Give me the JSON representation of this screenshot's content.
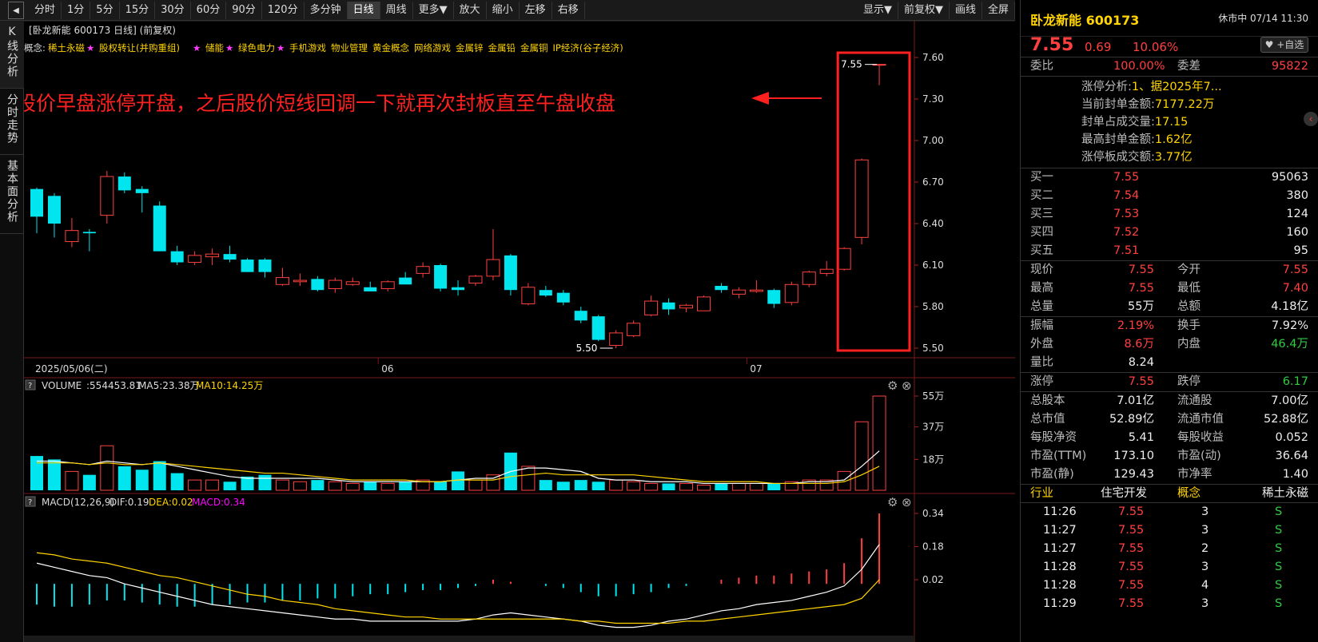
{
  "toolbar": {
    "collapse_glyph": "◀",
    "left": [
      "分时",
      "1分",
      "5分",
      "15分",
      "30分",
      "60分",
      "90分",
      "120分",
      "多分钟",
      "日线",
      "周线",
      "更多▼",
      "放大",
      "缩小",
      "左移",
      "右移"
    ],
    "active": "日线",
    "right": [
      "显示▼",
      "前复权▼",
      "画线",
      "全屏"
    ]
  },
  "left_tabs": [
    "K线分析",
    "分时走势",
    "基本面分析"
  ],
  "kline": {
    "header": "[卧龙新能 600173 日线] (前复权)",
    "concepts_label": "概念:",
    "concepts": [
      "稀土永磁",
      "股权转让(并购重组)",
      "储能",
      "绿色电力",
      "手机游戏",
      "物业管理",
      "黄金概念",
      "网络游戏",
      "金属锌",
      "金属铅",
      "金属铜",
      "IP经济(谷子经济)"
    ],
    "starred": [
      true,
      true,
      true,
      true,
      false,
      false,
      false,
      false,
      false,
      false,
      false,
      false
    ],
    "annotation": "股价早盘涨停开盘，之后股价短线回调一下就再次封板直至午盘收盘",
    "high_marker": "7.55",
    "low_marker": "5.50",
    "date_first": "2025/05/06(二)",
    "month_labels": [
      "06",
      "07"
    ],
    "y_ticks": [
      "7.60",
      "7.30",
      "7.00",
      "6.70",
      "6.40",
      "6.10",
      "5.80",
      "5.50"
    ]
  },
  "volume": {
    "label": "VOLUME",
    "value": ":554453.81",
    "ma5": "MA5:23.38万",
    "ma10": "MA10:14.25万",
    "y_ticks": [
      "55万",
      "37万",
      "18万"
    ]
  },
  "macd": {
    "label": "MACD(12,26,9)",
    "dif": "DIF:0.19",
    "dea": "DEA:0.02",
    "macd": "MACD:0.34",
    "y_ticks": [
      "0.34",
      "0.18",
      "0.02"
    ]
  },
  "colors": {
    "up": "#ff4040",
    "down": "#00e5ee",
    "ma5": "#ffffff",
    "ma10": "#ffd400",
    "box": "#ff2020",
    "annot": "#ff2020",
    "macd_text": "#ff00ff"
  },
  "chart_data": [
    {
      "type": "candlestick",
      "title": "卧龙新能 600173 日线",
      "ylim": [
        5.5,
        7.6
      ],
      "candles": [
        {
          "o": 6.65,
          "h": 6.66,
          "l": 6.33,
          "c": 6.45
        },
        {
          "o": 6.6,
          "h": 6.62,
          "l": 6.3,
          "c": 6.4
        },
        {
          "o": 6.27,
          "h": 6.44,
          "l": 6.23,
          "c": 6.35
        },
        {
          "o": 6.34,
          "h": 6.36,
          "l": 6.2,
          "c": 6.33
        },
        {
          "o": 6.46,
          "h": 6.78,
          "l": 6.4,
          "c": 6.74
        },
        {
          "o": 6.74,
          "h": 6.77,
          "l": 6.62,
          "c": 6.64
        },
        {
          "o": 6.65,
          "h": 6.67,
          "l": 6.48,
          "c": 6.62
        },
        {
          "o": 6.53,
          "h": 6.56,
          "l": 6.2,
          "c": 6.2
        },
        {
          "o": 6.2,
          "h": 6.24,
          "l": 6.1,
          "c": 6.12
        },
        {
          "o": 6.12,
          "h": 6.2,
          "l": 6.1,
          "c": 6.17
        },
        {
          "o": 6.16,
          "h": 6.22,
          "l": 6.1,
          "c": 6.18
        },
        {
          "o": 6.18,
          "h": 6.24,
          "l": 6.12,
          "c": 6.14
        },
        {
          "o": 6.14,
          "h": 6.15,
          "l": 6.05,
          "c": 6.05
        },
        {
          "o": 6.14,
          "h": 6.15,
          "l": 6.01,
          "c": 6.05
        },
        {
          "o": 5.96,
          "h": 6.08,
          "l": 5.95,
          "c": 6.01
        },
        {
          "o": 5.98,
          "h": 6.04,
          "l": 5.95,
          "c": 5.99
        },
        {
          "o": 6.0,
          "h": 6.02,
          "l": 5.91,
          "c": 5.92
        },
        {
          "o": 5.93,
          "h": 6.01,
          "l": 5.9,
          "c": 5.99
        },
        {
          "o": 5.96,
          "h": 6.01,
          "l": 5.95,
          "c": 5.98
        },
        {
          "o": 5.94,
          "h": 5.98,
          "l": 5.92,
          "c": 5.91
        },
        {
          "o": 5.93,
          "h": 5.99,
          "l": 5.91,
          "c": 5.98
        },
        {
          "o": 6.01,
          "h": 6.05,
          "l": 5.97,
          "c": 5.96
        },
        {
          "o": 6.04,
          "h": 6.12,
          "l": 6.01,
          "c": 6.09
        },
        {
          "o": 6.1,
          "h": 6.11,
          "l": 5.91,
          "c": 5.93
        },
        {
          "o": 5.94,
          "h": 5.99,
          "l": 5.88,
          "c": 5.92
        },
        {
          "o": 5.97,
          "h": 6.03,
          "l": 5.95,
          "c": 6.02
        },
        {
          "o": 6.02,
          "h": 6.36,
          "l": 5.99,
          "c": 6.14
        },
        {
          "o": 6.17,
          "h": 6.18,
          "l": 5.88,
          "c": 5.92
        },
        {
          "o": 5.82,
          "h": 5.97,
          "l": 5.81,
          "c": 5.94
        },
        {
          "o": 5.92,
          "h": 5.95,
          "l": 5.87,
          "c": 5.88
        },
        {
          "o": 5.9,
          "h": 5.92,
          "l": 5.81,
          "c": 5.83
        },
        {
          "o": 5.77,
          "h": 5.8,
          "l": 5.68,
          "c": 5.7
        },
        {
          "o": 5.73,
          "h": 5.74,
          "l": 5.55,
          "c": 5.56
        },
        {
          "o": 5.52,
          "h": 5.63,
          "l": 5.5,
          "c": 5.61
        },
        {
          "o": 5.59,
          "h": 5.7,
          "l": 5.58,
          "c": 5.68
        },
        {
          "o": 5.74,
          "h": 5.88,
          "l": 5.73,
          "c": 5.84
        },
        {
          "o": 5.83,
          "h": 5.86,
          "l": 5.74,
          "c": 5.78
        },
        {
          "o": 5.79,
          "h": 5.82,
          "l": 5.76,
          "c": 5.81
        },
        {
          "o": 5.77,
          "h": 5.88,
          "l": 5.77,
          "c": 5.87
        },
        {
          "o": 5.95,
          "h": 5.97,
          "l": 5.9,
          "c": 5.92
        },
        {
          "o": 5.89,
          "h": 5.94,
          "l": 5.86,
          "c": 5.92
        },
        {
          "o": 5.91,
          "h": 5.99,
          "l": 5.9,
          "c": 5.92
        },
        {
          "o": 5.92,
          "h": 5.93,
          "l": 5.79,
          "c": 5.82
        },
        {
          "o": 5.83,
          "h": 5.98,
          "l": 5.81,
          "c": 5.96
        },
        {
          "o": 5.96,
          "h": 6.06,
          "l": 5.94,
          "c": 6.05
        },
        {
          "o": 6.04,
          "h": 6.13,
          "l": 6.02,
          "c": 6.07
        },
        {
          "o": 6.07,
          "h": 6.23,
          "l": 6.06,
          "c": 6.22
        },
        {
          "o": 6.3,
          "h": 6.87,
          "l": 6.25,
          "c": 6.86
        },
        {
          "o": 7.55,
          "h": 7.55,
          "l": 7.4,
          "c": 7.55
        }
      ],
      "volume": [
        20,
        18,
        11,
        9,
        26,
        14,
        12,
        17,
        10,
        6,
        6,
        5,
        8,
        9,
        6,
        5,
        6,
        5,
        4,
        5,
        4,
        5,
        6,
        5,
        11,
        6,
        9,
        22,
        14,
        6,
        5,
        6,
        5,
        6,
        5,
        4,
        4,
        4,
        3,
        4,
        4,
        4,
        4,
        5,
        6,
        6,
        11,
        40,
        55
      ],
      "ma5_vol": [
        17,
        17,
        16,
        15,
        17,
        16,
        15,
        16,
        14,
        12,
        10,
        8,
        7,
        7,
        7,
        7,
        7,
        6,
        5,
        5,
        5,
        5,
        5,
        5,
        6,
        7,
        7,
        11,
        13,
        13,
        12,
        11,
        7,
        6,
        6,
        5,
        5,
        5,
        4,
        4,
        4,
        4,
        4,
        4,
        5,
        5,
        6,
        14,
        23
      ],
      "ma10_vol": [
        16,
        16,
        16,
        15,
        16,
        15,
        15,
        16,
        15,
        14,
        13,
        12,
        11,
        10,
        10,
        9,
        8,
        7,
        6,
        6,
        6,
        6,
        5,
        5,
        6,
        6,
        6,
        8,
        9,
        10,
        9,
        9,
        9,
        9,
        9,
        8,
        7,
        6,
        5,
        5,
        5,
        5,
        4,
        4,
        4,
        4,
        5,
        9,
        14
      ],
      "macd_bars": [
        -0.1,
        -0.11,
        -0.11,
        -0.1,
        -0.08,
        -0.08,
        -0.09,
        -0.1,
        -0.11,
        -0.11,
        -0.1,
        -0.1,
        -0.09,
        -0.09,
        -0.08,
        -0.08,
        -0.07,
        -0.07,
        -0.06,
        -0.05,
        -0.05,
        -0.04,
        -0.03,
        -0.03,
        -0.02,
        -0.01,
        0.02,
        0.01,
        0.0,
        -0.01,
        -0.02,
        -0.04,
        -0.06,
        -0.06,
        -0.05,
        -0.04,
        -0.02,
        -0.01,
        0.0,
        0.02,
        0.03,
        0.04,
        0.04,
        0.05,
        0.06,
        0.07,
        0.1,
        0.22,
        0.34
      ],
      "dif": [
        0.1,
        0.08,
        0.06,
        0.04,
        0.03,
        0.0,
        -0.02,
        -0.04,
        -0.06,
        -0.08,
        -0.1,
        -0.11,
        -0.12,
        -0.13,
        -0.14,
        -0.15,
        -0.16,
        -0.17,
        -0.17,
        -0.18,
        -0.18,
        -0.18,
        -0.18,
        -0.18,
        -0.18,
        -0.17,
        -0.15,
        -0.14,
        -0.15,
        -0.16,
        -0.17,
        -0.18,
        -0.2,
        -0.21,
        -0.21,
        -0.2,
        -0.18,
        -0.17,
        -0.15,
        -0.13,
        -0.12,
        -0.1,
        -0.09,
        -0.08,
        -0.06,
        -0.04,
        -0.01,
        0.07,
        0.19
      ],
      "dea": [
        0.15,
        0.14,
        0.12,
        0.11,
        0.1,
        0.08,
        0.06,
        0.04,
        0.03,
        0.01,
        -0.01,
        -0.03,
        -0.05,
        -0.06,
        -0.08,
        -0.09,
        -0.1,
        -0.12,
        -0.13,
        -0.14,
        -0.15,
        -0.16,
        -0.16,
        -0.17,
        -0.17,
        -0.17,
        -0.17,
        -0.17,
        -0.17,
        -0.17,
        -0.17,
        -0.18,
        -0.18,
        -0.19,
        -0.19,
        -0.19,
        -0.19,
        -0.18,
        -0.18,
        -0.17,
        -0.16,
        -0.15,
        -0.14,
        -0.13,
        -0.12,
        -0.11,
        -0.1,
        -0.07,
        0.02
      ]
    }
  ],
  "quote": {
    "name": "卧龙新能 600173",
    "status": "休市中 07/14 11:30",
    "price": "7.55",
    "change": "0.69",
    "pct": "10.06%",
    "fav": "♥ +自选",
    "weibi_label": "委比",
    "weibi": "100.00%",
    "weicha_label": "委差",
    "weicha": "95822",
    "zt": [
      {
        "label": "涨停分析:",
        "value": "1、据2025年7..."
      },
      {
        "label": "当前封单金额:",
        "value": "7177.22万"
      },
      {
        "label": "封单占成交量:",
        "value": "17.15"
      },
      {
        "label": "最高封单金额:",
        "value": "1.62亿"
      },
      {
        "label": "涨停板成交额:",
        "value": "3.77亿"
      }
    ],
    "bids": [
      {
        "label": "买一",
        "price": "7.55",
        "vol": "95063"
      },
      {
        "label": "买二",
        "price": "7.54",
        "vol": "380"
      },
      {
        "label": "买三",
        "price": "7.53",
        "vol": "124"
      },
      {
        "label": "买四",
        "price": "7.52",
        "vol": "160"
      },
      {
        "label": "买五",
        "price": "7.51",
        "vol": "95"
      }
    ],
    "stats1": [
      {
        "l1": "现价",
        "v1": "7.55",
        "c1": "red",
        "l2": "今开",
        "v2": "7.55",
        "c2": "red"
      },
      {
        "l1": "最高",
        "v1": "7.55",
        "c1": "red",
        "l2": "最低",
        "v2": "7.40",
        "c2": "red"
      },
      {
        "l1": "总量",
        "v1": "55万",
        "c1": "wht",
        "l2": "总额",
        "v2": "4.18亿",
        "c2": "wht"
      }
    ],
    "stats2": [
      {
        "l1": "振幅",
        "v1": "2.19%",
        "c1": "red",
        "l2": "换手",
        "v2": "7.92%",
        "c2": "wht"
      },
      {
        "l1": "外盘",
        "v1": "8.6万",
        "c1": "red",
        "l2": "内盘",
        "v2": "46.4万",
        "c2": "grn"
      },
      {
        "l1": "量比",
        "v1": "8.24",
        "c1": "wht",
        "l2": "",
        "v2": "",
        "c2": "wht"
      }
    ],
    "stats3": [
      {
        "l1": "涨停",
        "v1": "7.55",
        "c1": "red",
        "l2": "跌停",
        "v2": "6.17",
        "c2": "grn"
      }
    ],
    "stats4": [
      {
        "l1": "总股本",
        "v1": "7.01亿",
        "c1": "wht",
        "l2": "流通股",
        "v2": "7.00亿",
        "c2": "wht"
      },
      {
        "l1": "总市值",
        "v1": "52.89亿",
        "c1": "wht",
        "l2": "流通市值",
        "v2": "52.88亿",
        "c2": "wht"
      },
      {
        "l1": "每股净资",
        "v1": "5.41",
        "c1": "wht",
        "l2": "每股收益",
        "v2": "0.052",
        "c2": "wht"
      },
      {
        "l1": "市盈(TTM)",
        "v1": "173.10",
        "c1": "wht",
        "l2": "市盈(动)",
        "v2": "36.64",
        "c2": "wht"
      },
      {
        "l1": "市盈(静)",
        "v1": "129.43",
        "c1": "wht",
        "l2": "市净率",
        "v2": "1.40",
        "c2": "wht"
      }
    ],
    "industry_label": "行业",
    "industry": "住宅开发",
    "concept_label": "概念",
    "concept": "稀土永磁",
    "ticks": [
      {
        "t": "11:26",
        "p": "7.55",
        "v": "3",
        "s": "S"
      },
      {
        "t": "11:27",
        "p": "7.55",
        "v": "3",
        "s": "S"
      },
      {
        "t": "11:27",
        "p": "7.55",
        "v": "2",
        "s": "S"
      },
      {
        "t": "11:28",
        "p": "7.55",
        "v": "3",
        "s": "S"
      },
      {
        "t": "11:28",
        "p": "7.55",
        "v": "4",
        "s": "S"
      },
      {
        "t": "11:29",
        "p": "7.55",
        "v": "3",
        "s": "S"
      }
    ]
  }
}
